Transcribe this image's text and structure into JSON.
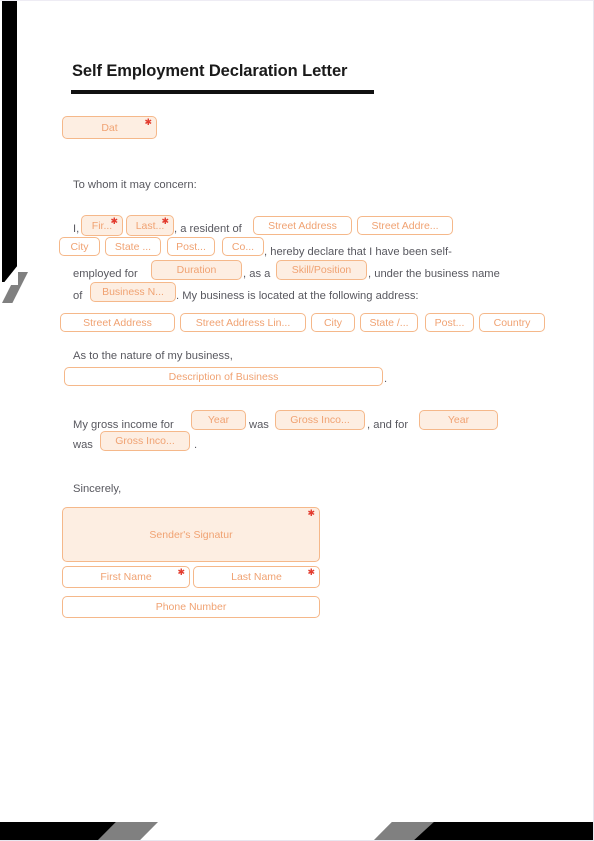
{
  "document": {
    "title": "Self Employment Declaration Letter",
    "salutation": "To whom it may concern:",
    "paragraph1": {
      "t_i": "I,",
      "t_resident_of": ", a resident of",
      "t_hereby": ", hereby declare that I have been self-",
      "t_employed_for": "employed for",
      "t_as_a": ", as a",
      "t_under_business": ", under the business name",
      "t_of": "of",
      "t_located": ". My business is located at the following address:"
    },
    "paragraph2": {
      "t_nature": "As to the nature of my business,",
      "t_period": "."
    },
    "paragraph3": {
      "t_gross_income_for": "My gross income for",
      "t_was_1": "was",
      "t_and_for": ", and for",
      "t_was_2": "was",
      "t_period": "."
    },
    "closing": "Sincerely,"
  },
  "fields": {
    "date": {
      "label": "Dat",
      "required": true,
      "filled": true
    },
    "first_name_inline": {
      "label": "Fir...",
      "required": true,
      "filled": true
    },
    "last_name_inline": {
      "label": "Last...",
      "required": true,
      "filled": true
    },
    "res_street_address": {
      "label": "Street Address",
      "required": false,
      "filled": false
    },
    "res_street_address_2": {
      "label": "Street Addre...",
      "required": false,
      "filled": false
    },
    "res_city": {
      "label": "City",
      "required": false,
      "filled": false
    },
    "res_state": {
      "label": "State ...",
      "required": false,
      "filled": false
    },
    "res_postal": {
      "label": "Post...",
      "required": false,
      "filled": false
    },
    "res_country": {
      "label": "Co...",
      "required": false,
      "filled": false
    },
    "duration": {
      "label": "Duration",
      "required": false,
      "filled": true
    },
    "skill_position": {
      "label": "Skill/Position",
      "required": false,
      "filled": true
    },
    "business_name": {
      "label": "Business N...",
      "required": false,
      "filled": true
    },
    "biz_street_address": {
      "label": "Street Address",
      "required": false,
      "filled": false
    },
    "biz_street_address_2": {
      "label": "Street Address Lin...",
      "required": false,
      "filled": false
    },
    "biz_city": {
      "label": "City",
      "required": false,
      "filled": false
    },
    "biz_state": {
      "label": "State /...",
      "required": false,
      "filled": false
    },
    "biz_postal": {
      "label": "Post...",
      "required": false,
      "filled": false
    },
    "biz_country": {
      "label": "Country",
      "required": false,
      "filled": false
    },
    "description_of_business": {
      "label": "Description of Business",
      "required": false,
      "filled": false
    },
    "year_1": {
      "label": "Year",
      "required": false,
      "filled": true
    },
    "gross_income_1": {
      "label": "Gross Inco...",
      "required": false,
      "filled": true
    },
    "year_2": {
      "label": "Year",
      "required": false,
      "filled": true
    },
    "gross_income_2": {
      "label": "Gross Inco...",
      "required": false,
      "filled": true
    },
    "senders_signature": {
      "label": "Sender's Signatur",
      "required": true,
      "filled": true
    },
    "signer_first_name": {
      "label": "First Name",
      "required": true,
      "filled": false
    },
    "signer_last_name": {
      "label": "Last Name",
      "required": true,
      "filled": false
    },
    "phone_number": {
      "label": "Phone Number",
      "required": false,
      "filled": false
    }
  },
  "colors": {
    "field_border": "#f5b88a",
    "field_fill": "#fdeee2",
    "field_text": "#f0a272",
    "required_asterisk": "#e23b2e",
    "body_text": "#58585f",
    "title_text": "#1a1a1a",
    "deco_black": "#000000",
    "deco_grey": "#808080"
  },
  "icons": {
    "required_marker": "asterisk-icon"
  }
}
